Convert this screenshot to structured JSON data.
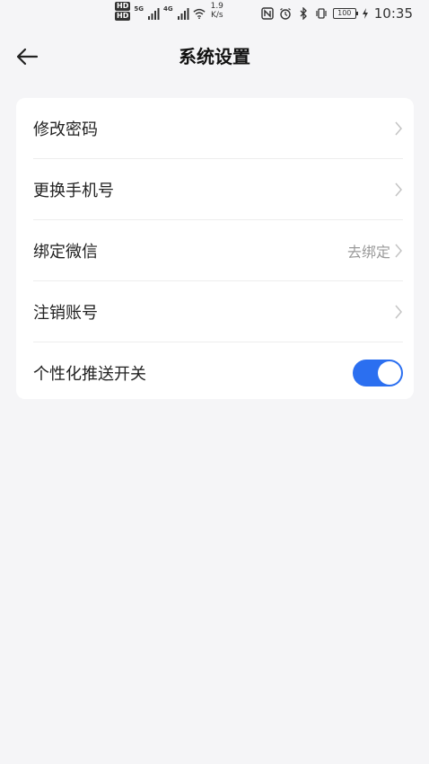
{
  "status_bar": {
    "hd_top": "HD",
    "hd_bottom": "HD",
    "net_5g": "5G",
    "net_4g": "4G",
    "speed_value": "1.9",
    "speed_unit": "K/s",
    "battery": "100",
    "time": "10:35"
  },
  "header": {
    "title": "系统设置"
  },
  "settings": {
    "items": [
      {
        "label": "修改密码"
      },
      {
        "label": "更换手机号"
      },
      {
        "label": "绑定微信",
        "value": "去绑定"
      },
      {
        "label": "注销账号"
      },
      {
        "label": "个性化推送开关",
        "toggle_on": true
      }
    ]
  },
  "colors": {
    "accent": "#2b6ff0",
    "background": "#f5f5f7",
    "card": "#ffffff",
    "secondary_text": "#9a9a9a"
  }
}
